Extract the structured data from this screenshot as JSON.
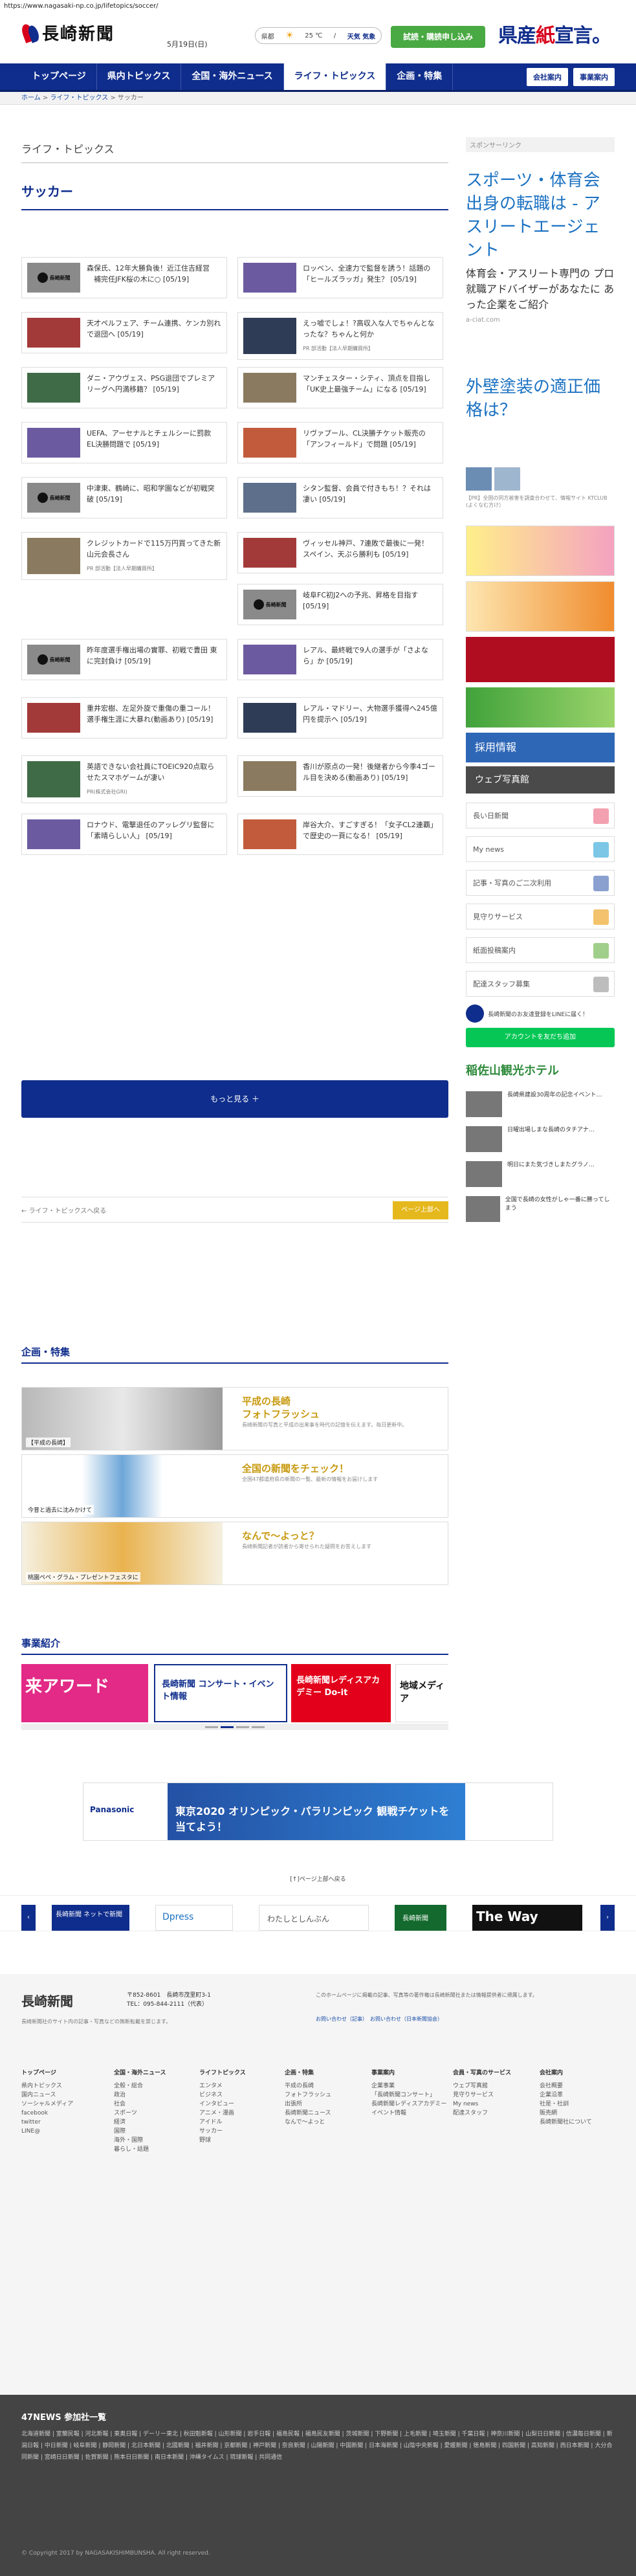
{
  "url": "https://www.nagasaki-np.co.jp/lifetopics/soccer/",
  "header": {
    "logo": "長崎新聞",
    "date": "5月19日(日)",
    "weather": {
      "city": "県都",
      "temp": "25 ℃",
      "sep": "/",
      "detail": "天気 気象"
    },
    "trial_button": "試読・購読申し込み",
    "ad_text_a": "県産",
    "ad_text_b": "紙",
    "ad_text_c": "宣言。"
  },
  "nav": {
    "items": [
      "トップページ",
      "県内トピックス",
      "全国・海外ニュース",
      "ライフ・トピックス",
      "企画・特集"
    ],
    "active": 3,
    "right": [
      "会社案内",
      "事業案内"
    ]
  },
  "breadcrumb": [
    "ホーム",
    "ライフ・トピックス",
    "サッカー"
  ],
  "section_title": "ライフ・トピックス",
  "page_heading": "サッカー",
  "articles_left": [
    {
      "title": "森保氏、12年大勝負後！近江住吉経営 　補完任JFK桜の木に○ ",
      "date": "[05/19]",
      "thumb": "logo"
    },
    {
      "title": "天才ペルフェア、チーム連携、ケンカ別れで退団へ ",
      "date": "[05/19]",
      "thumb": "photo"
    },
    {
      "title": "ダニ・アウヴェス、PSG退団でプレミアリーグへ円満移籍？",
      "date": "[05/19]",
      "thumb": "photo"
    },
    {
      "title": "UEFA、アーセナルとチェルシーに罰款 EL決勝問題で",
      "date": "[05/19]",
      "thumb": "photo"
    },
    {
      "title": "中津東、鶴崎に、昭和学園などが初戦突破",
      "date": "[05/19]",
      "thumb": "logo"
    },
    {
      "title": "クレジットカードで115万円買ってきた新山元会長さん",
      "date": "",
      "thumb": "photo",
      "sub": "PR 部活動【法人早期購買所】"
    },
    {
      "title": "",
      "date": "",
      "thumb": "none"
    },
    {
      "title": "昨年度選手権出場の實罪、初戦で豊田 東に完封負け",
      "date": "[05/19]",
      "thumb": "logo"
    },
    {
      "title": "重井宏樹、左足外旋で重傷の重コール！選手権生涯に大暴れ(動画あり)",
      "date": "[05/19]",
      "thumb": "photo"
    },
    {
      "title": "英語できない会社員にTOEIC920点取らせたスマホゲームが凄い",
      "date": "",
      "thumb": "photo",
      "sub": "PR(株式会社GRI)"
    },
    {
      "title": "ロナウド、電撃退任のアッレグリ監督に「素晴らしい人」",
      "date": "[05/19]",
      "thumb": "photo"
    }
  ],
  "articles_right": [
    {
      "title": "ロッベン、全速力で監督を誘う！話題の「ヒールズラッガ」発生？",
      "date": "[05/19]",
      "thumb": "photo"
    },
    {
      "title": "えっ嘘でしょ！?高収入な人でちゃんとなったな？ちゃんと何か",
      "date": "",
      "thumb": "photo",
      "sub": "PR 部活動【法人早期購買所】"
    },
    {
      "title": "マンチェスター・シティ、頂点を目指し「UK史上最強チーム」になる",
      "date": "[05/19]",
      "thumb": "photo"
    },
    {
      "title": "リヴァプール、CL決勝チケット販売の「アンフィールド」で問題",
      "date": "[05/19]",
      "thumb": "photo"
    },
    {
      "title": "シタン監督、会員で付きもち！？それは凄い",
      "date": "[05/19]",
      "thumb": "photo"
    },
    {
      "title": "ヴィッセル神戸、7連敗で最後に一発！ スペイン、天ぷら勝利も",
      "date": "[05/19]",
      "thumb": "photo"
    },
    {
      "title": "岐阜FC初J2への予兆、昇格を目指す",
      "date": "[05/19]",
      "thumb": "logo"
    },
    {
      "title": "レアル、最終戦で9人の選手が「さよなら」か",
      "date": "[05/19]",
      "thumb": "photo"
    },
    {
      "title": "レアル・マドリー、大物選手獲得へ245億円を提示へ",
      "date": "[05/19]",
      "thumb": "photo"
    },
    {
      "title": "香川が原点の一発！後継者から今季4ゴール目を決める(動画あり)",
      "date": "[05/19]",
      "thumb": "photo"
    },
    {
      "title": "岸谷大介、すごすぎる！「女子CL2連覇」で歴史の一頁になる！",
      "date": "[05/19]",
      "thumb": "photo"
    }
  ],
  "more_button": "もっと見る ＋",
  "pager": {
    "back": "ライフ・トピックスへ戻る",
    "next": "ページ上部へ"
  },
  "kikaku": {
    "heading": "企画・特集",
    "features": [
      {
        "title": "平成の長崎",
        "title2": "フォトフラッシュ",
        "desc": "長崎新聞の写真と平成の出来事を時代の記憶を伝えます。毎日更新中。",
        "cap": "【平成の長崎】",
        "cap2": "(03/37)"
      },
      {
        "title": "全国の新聞をチェック！",
        "title2": "",
        "desc": "全国47都道府県の新聞の一覧、最新の情報をお届けします",
        "cap": "今昔と過去に沈みかけて",
        "cap2": "平成最後の日本最南端"
      },
      {
        "title": "なんで〜よっと？",
        "title2": "",
        "desc": "長崎新聞記者が読者から寄せられた疑問をお答えします",
        "cap": "桃園ペペ・グラム・プレゼントフェスタに",
        "cap2": ""
      }
    ]
  },
  "jigyo": {
    "heading": "事業紹介",
    "items": [
      "来アワード",
      "長崎新聞 コンサート・イベント情報",
      "長崎新聞レディスアカデミー Do-it",
      "地域メディア"
    ]
  },
  "sidebar": {
    "sponsor_label": "スポンサーリンク",
    "ad1_title": "スポーツ・体育会出身の転職は - アスリートエージェント",
    "ad1_body": "体育会・アスリート専門の プロ就職アドバイザーがあなたに あった企業をご紹介",
    "ad1_url": "a-ciat.com",
    "ad2_title": "外壁塗装の適正価格は？",
    "ad2_sub": "【PR】全国の同方被害を調査合わせて、情報サイト KTCLUB (よくなむ方け）",
    "banners": [
      "長い日新聞",
      "My news",
      "記事・写真のご二次利用",
      "見守りサービス",
      "紙面投稿案内",
      "配達スタッフ募集"
    ],
    "line_label": "長崎新聞のお友達登録をLINEに届く！",
    "line_button": "アカウントを友だち追加",
    "hotel": "稲佐山観光ホテル",
    "side_news": [
      "長崎県建設30周年の記念イベント…",
      "日曜出場しまな長崎のタチアナ…",
      "明日にまた気づきしまたグラノ…",
      "全国で長崎の女性がしゃ一番に勝ってしまう"
    ],
    "recruit": "採用情報",
    "web": "ウェブ写真館"
  },
  "ad_wide_text": "東京2020 オリンピック・パラリンピック 観戦チケットを当てよう！",
  "back_top": "[↑]ページ上部へ戻る",
  "link_banners": [
    "長崎新聞 ネットで新聞",
    "Dpress",
    "わたしとしんぶん",
    "長崎新聞",
    "The Way"
  ],
  "footer": {
    "logo": "長崎新聞",
    "address": "〒852-8601　長崎市茂里町3-1",
    "tel": "TEL：095-844-2111（代表）",
    "note": "長崎新聞社のサイト内の記事・写真などの無断転載を禁じます。",
    "notice": "このホームページに掲載の記事、写真等の著作権は長崎新聞社または情報提供者に帰属します。",
    "links": [
      "お問い合わせ（記事）",
      "お問い合わせ（日本新聞協会）"
    ],
    "cols": [
      {
        "head": "トップページ",
        "items": [
          "県内トピックス",
          "国内ニュース",
          "ソーシャルメディア",
          "facebook",
          "twitter",
          "LINE@"
        ]
      },
      {
        "head": "全国・海外ニュース",
        "items": [
          "全般・総合",
          "政治",
          "社会",
          "スポーツ",
          "経済",
          "国際",
          "海外・国際",
          "暮らし・話題"
        ]
      },
      {
        "head": "ライフトピックス",
        "items": [
          "エンタメ",
          "ビジネス",
          "インタビュー",
          "アニメ・漫画",
          "アイドル",
          "サッカー",
          "野球"
        ]
      },
      {
        "head": "企画・特集",
        "items": [
          "平成の長崎",
          "フォトフラッシュ",
          "出張所",
          "長崎新聞ニュース",
          "なんで～よっと"
        ]
      },
      {
        "head": "事業案内",
        "items": [
          "企業事業",
          "「長崎新聞コンサート」",
          "長崎新聞レディスアカデミー",
          "イベント情報"
        ]
      },
      {
        "head": "会員・写真のサービス",
        "items": [
          "ウェブ写真館",
          "見守りサービス",
          "My news",
          "配達スタッフ"
        ]
      },
      {
        "head": "会社案内",
        "items": [
          "会社概要",
          "企業沿革",
          "社是・社訓",
          "販売網",
          "長崎新聞社について"
        ]
      }
    ]
  },
  "footer47": {
    "heading": "47NEWS 参加社一覧",
    "copyright": "© Copyright 2017 by NAGASAKISHIMBUNSHA. All right reserved."
  }
}
